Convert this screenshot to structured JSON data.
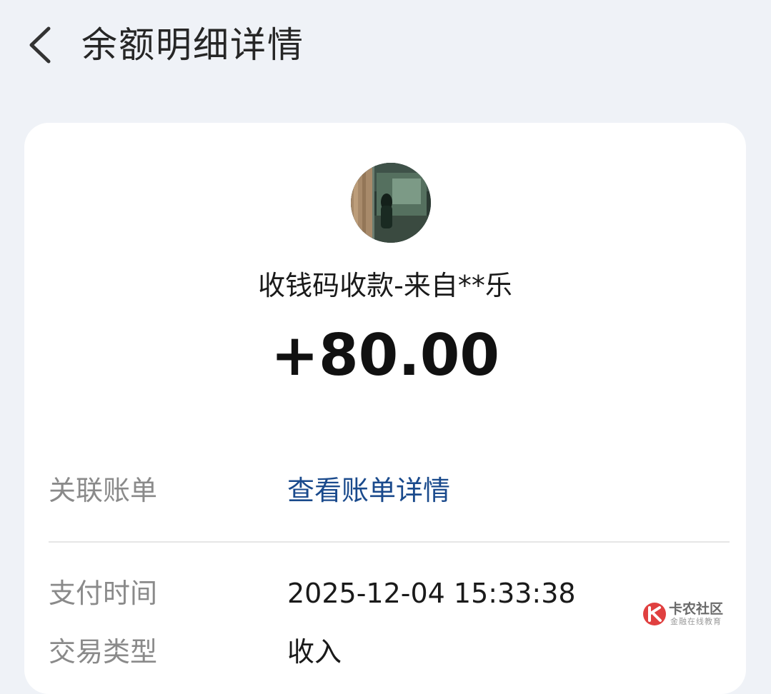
{
  "header": {
    "title": "余额明细详情"
  },
  "transaction": {
    "description": "收钱码收款-来自**乐",
    "amount": "+80.00"
  },
  "details": {
    "related_bill_label": "关联账单",
    "related_bill_link": "查看账单详情",
    "pay_time_label": "支付时间",
    "pay_time_value": "2025-12-04 15:33:38",
    "type_label": "交易类型",
    "type_value": "收入"
  },
  "watermark": {
    "title": "卡农社区",
    "subtitle": "金融在线教育"
  },
  "colors": {
    "background": "#eff2f7",
    "card": "#ffffff",
    "link": "#1a4a8c",
    "label_gray": "#8a8a8a"
  },
  "icons": {
    "back": "chevron-left-icon"
  }
}
